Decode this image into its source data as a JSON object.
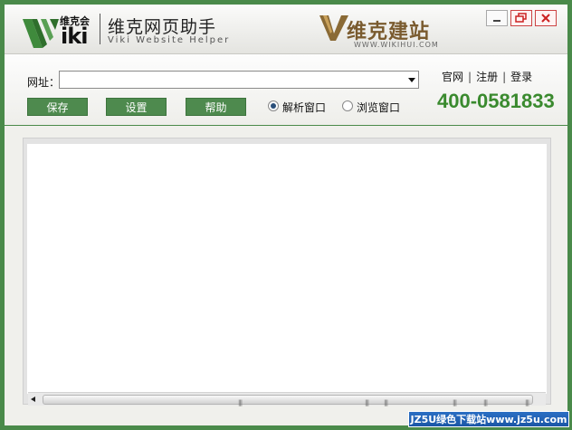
{
  "header": {
    "logo_small": "维克会",
    "logo_text": "iki",
    "title": "维克网页助手",
    "subtitle": "Viki Website Helper",
    "brand_name": "维克建站",
    "brand_url": "WWW.WIKIHUI.COM"
  },
  "toolbar": {
    "url_label": "网址：",
    "url_value": "",
    "buttons": {
      "save": "保存",
      "settings": "设置",
      "help": "帮助"
    },
    "radio": {
      "parse": "解析窗口",
      "browse": "浏览窗口",
      "selected": "parse"
    },
    "links": {
      "official": "官网",
      "register": "注册",
      "login": "登录"
    },
    "phone": "400-0581833"
  },
  "watermark": "JZ5U绿色下载站www.jz5u.com",
  "colors": {
    "accent_green": "#4e8a4e",
    "phone_green": "#3a8a2e",
    "brand_brown": "#7a5b2f"
  }
}
